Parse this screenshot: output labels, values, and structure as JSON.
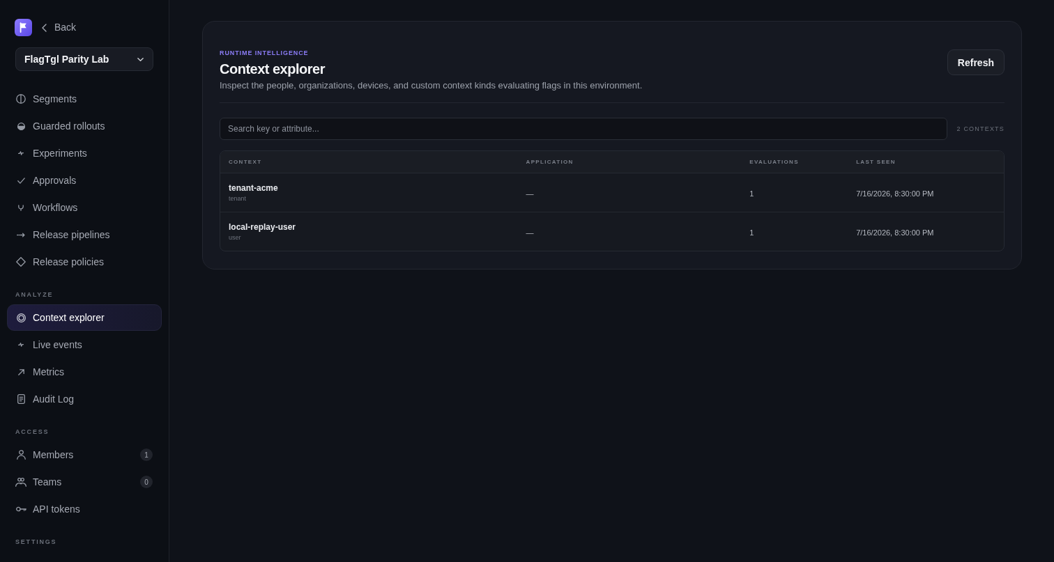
{
  "sidebar": {
    "back_link": "Back",
    "workspace_select": {
      "value": "FlagTgl Parity Lab"
    },
    "sections": [
      {
        "items": [
          {
            "label": "Segments",
            "selected": false
          },
          {
            "label": "Guarded rollouts",
            "selected": false
          },
          {
            "label": "Experiments",
            "selected": false
          },
          {
            "label": "Approvals",
            "selected": false
          },
          {
            "label": "Workflows",
            "selected": false
          },
          {
            "label": "Release pipelines",
            "selected": false
          },
          {
            "label": "Release policies",
            "selected": false
          }
        ]
      },
      {
        "title": "ANALYZE",
        "items": [
          {
            "label": "Context explorer",
            "selected": true
          },
          {
            "label": "Live events",
            "selected": false
          },
          {
            "label": "Metrics",
            "selected": false
          },
          {
            "label": "Audit Log",
            "selected": false
          }
        ]
      },
      {
        "title": "ACCESS",
        "items": [
          {
            "label": "Members",
            "selected": false,
            "count": "1"
          },
          {
            "label": "Teams",
            "selected": false,
            "count": "0"
          },
          {
            "label": "API tokens",
            "selected": false
          }
        ]
      },
      {
        "title": "SETTINGS"
      }
    ]
  },
  "header": {
    "eyebrow": "RUNTIME INTELLIGENCE",
    "title": "Context explorer",
    "description": "Inspect the people, organizations, devices, and custom context kinds evaluating flags in this environment.",
    "refresh_button": "Refresh"
  },
  "search": {
    "placeholder": "Search key or attribute..."
  },
  "context_count": "2 CONTEXTS",
  "table": {
    "columns": [
      "CONTEXT",
      "APPLICATION",
      "EVALUATIONS",
      "LAST SEEN"
    ],
    "rows": [
      {
        "key": "tenant-acme",
        "context_kind": "tenant",
        "application": "—",
        "evaluations": "1",
        "last_seen": "7/16/2026, 8:30:00 PM"
      },
      {
        "key": "local-replay-user",
        "context_kind": "user",
        "application": "—",
        "evaluations": "1",
        "last_seen": "7/16/2026, 8:30:00 PM"
      }
    ]
  }
}
